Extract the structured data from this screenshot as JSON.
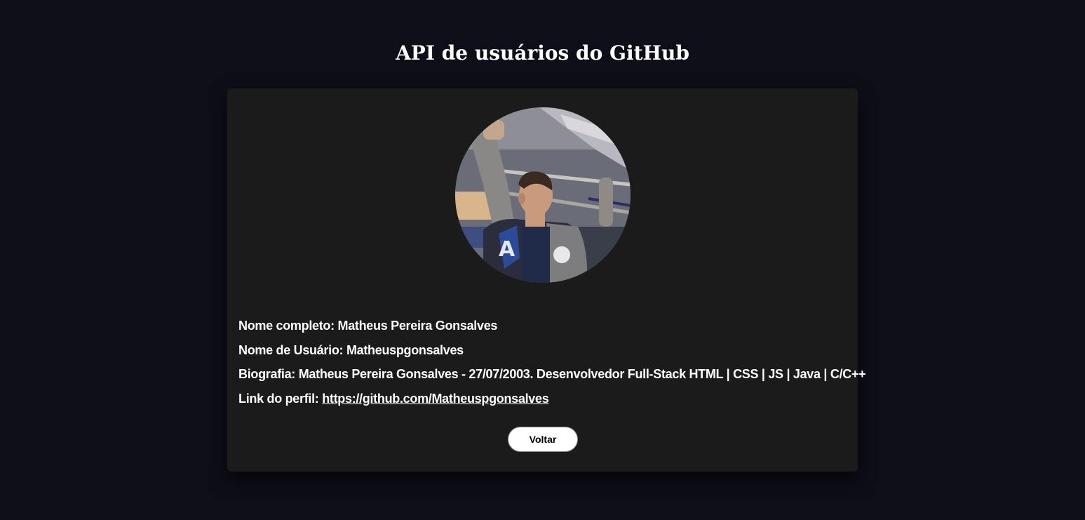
{
  "page": {
    "title": "API de usuários do GitHub"
  },
  "profile": {
    "avatar_description": "profile-photo",
    "full_name_label": "Nome completo:",
    "full_name": "Matheus Pereira Gonsalves",
    "username_label": "Nome de Usuário:",
    "username": "Matheuspgonsalves",
    "bio_label": "Biografia:",
    "bio": "Matheus Pereira Gonsalves - 27/07/2003. Desenvolvedor Full-Stack HTML | CSS | JS | Java | C/C++",
    "link_label": "Link do perfil:",
    "link": "https://github.com/Matheuspgonsalves"
  },
  "actions": {
    "back_label": "Voltar"
  },
  "colors": {
    "background": "#0e0e19",
    "card": "#1b1b1b",
    "text": "#ffffff",
    "button_bg": "#ffffff",
    "button_text": "#000000"
  }
}
